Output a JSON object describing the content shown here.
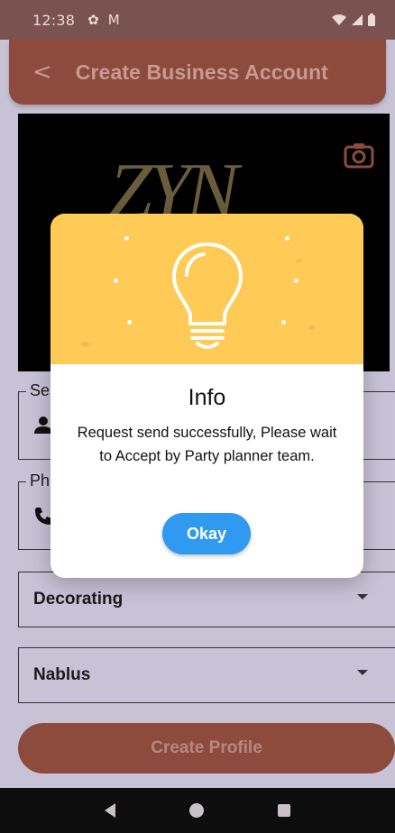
{
  "status_bar": {
    "time": "12:38",
    "settings_icon": "gear-icon",
    "mail_icon": "gmail-icon",
    "wifi_icon": "wifi-icon",
    "signal_icon": "signal-icon",
    "battery_icon": "battery-icon"
  },
  "app_bar": {
    "back_icon": "arrow-back-icon",
    "title": "Create Business Account"
  },
  "cover": {
    "logo_text": "ZYN",
    "camera_icon": "camera-icon"
  },
  "form": {
    "service_field_label": "Se",
    "phone_field_label": "Ph",
    "category_value": "Decorating",
    "city_value": "Nablus",
    "create_button_label": "Create Profile"
  },
  "dialog": {
    "icon": "lightbulb-icon",
    "title": "Info",
    "message": "Request send successfully, Please wait to Accept by Party planner team.",
    "okay_label": "Okay"
  },
  "colors": {
    "accent": "#8c4b3d",
    "dialog_banner": "#ffca55",
    "okay_button": "#2f9af0",
    "scrim_background": "#c8c2d6"
  }
}
